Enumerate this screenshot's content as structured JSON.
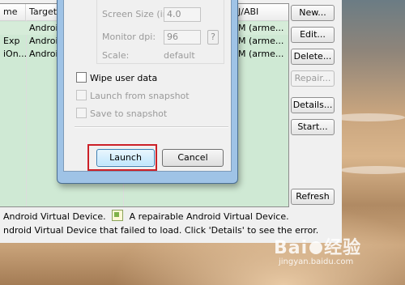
{
  "list": {
    "columns": [
      "me",
      "Target",
      "J/ABI"
    ],
    "rows": [
      {
        "name": "",
        "target": "Android",
        "abi": "M (arme..."
      },
      {
        "name": "Exp",
        "target": "Android",
        "abi": "M (arme..."
      },
      {
        "name": "iOn...",
        "target": "Android",
        "abi": "M (arme..."
      }
    ]
  },
  "buttons": {
    "new": "New...",
    "edit": "Edit...",
    "delete": "Delete...",
    "repair": "Repair...",
    "details": "Details...",
    "start": "Start...",
    "refresh": "Refresh"
  },
  "legend": {
    "line1_left": "Android Virtual Device.",
    "line1_right": "A repairable Android Virtual Device.",
    "line2": "ndroid Virtual Device that failed to load. Click 'Details' to see the error."
  },
  "dialog": {
    "screen_size_label": "Screen Size (in):",
    "screen_size_value": "4.0",
    "monitor_dpi_label": "Monitor dpi:",
    "monitor_dpi_value": "96",
    "help_label": "?",
    "scale_label": "Scale:",
    "scale_value": "default",
    "wipe_user_data": "Wipe user data",
    "launch_from_snapshot": "Launch from snapshot",
    "save_to_snapshot": "Save to snapshot",
    "launch_button": "Launch",
    "cancel_button": "Cancel"
  },
  "watermark": {
    "brand_left": "Bai",
    "brand_right": "经验",
    "url": "jingyan.baidu.com"
  },
  "colors": {
    "list_background": "#cfe9d4",
    "highlight_border": "#cc2027"
  }
}
